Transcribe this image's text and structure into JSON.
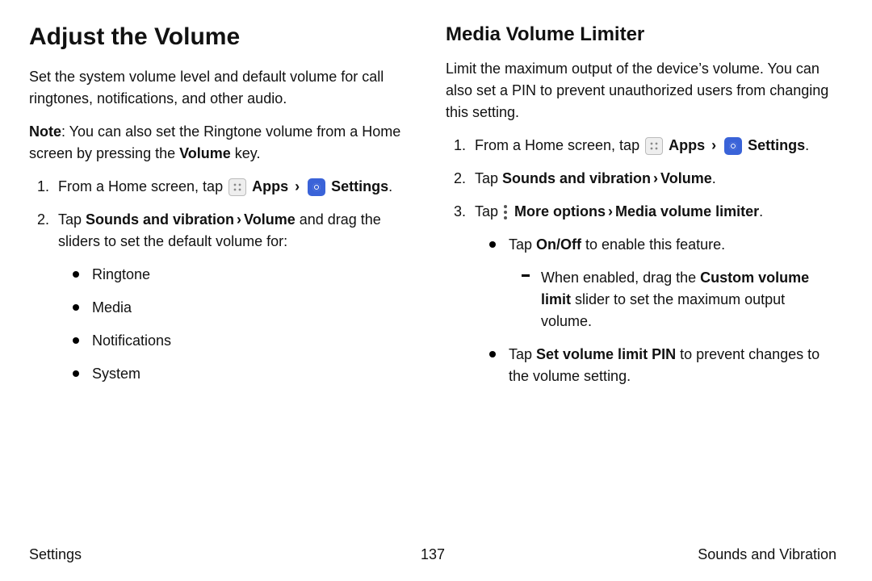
{
  "left": {
    "heading": "Adjust the Volume",
    "intro": "Set the system volume level and default volume for call ringtones, notifications, and other audio.",
    "note_label": "Note",
    "note_a": ": You can also set the Ringtone volume from a Home screen by pressing the ",
    "note_bold": "Volume",
    "note_b": " key.",
    "step1a": "From a Home screen, tap ",
    "apps": "Apps",
    "settings": "Settings",
    "dot": ".",
    "step2a": "Tap ",
    "step2b": "Sounds and vibration",
    "step2c": "Volume",
    "step2d": " and drag the sliders to set the default volume for:",
    "items": [
      "Ringtone",
      "Media",
      "Notifications",
      "System"
    ]
  },
  "right": {
    "heading": "Media Volume Limiter",
    "intro": "Limit the maximum output of the device’s volume. You can also set a PIN to prevent unauthorized users from changing this setting.",
    "step1a": "From a Home screen, tap ",
    "apps": "Apps",
    "settings": "Settings",
    "dot": ".",
    "step2a": "Tap ",
    "step2b": "Sounds and vibration",
    "step2c": "Volume",
    "step3a": "Tap ",
    "step3b": "More options",
    "step3c": "Media volume limiter",
    "bullet1a": "Tap ",
    "bullet1b": "On/Off",
    "bullet1c": " to enable this feature.",
    "dash1a": "When enabled, drag the ",
    "dash1b": "Custom volume limit",
    "dash1c": " slider to set the maximum output volume.",
    "bullet2a": "Tap ",
    "bullet2b": "Set volume limit PIN",
    "bullet2c": " to prevent changes to the volume setting."
  },
  "footer": {
    "left": "Settings",
    "center": "137",
    "right": "Sounds and Vibration"
  }
}
